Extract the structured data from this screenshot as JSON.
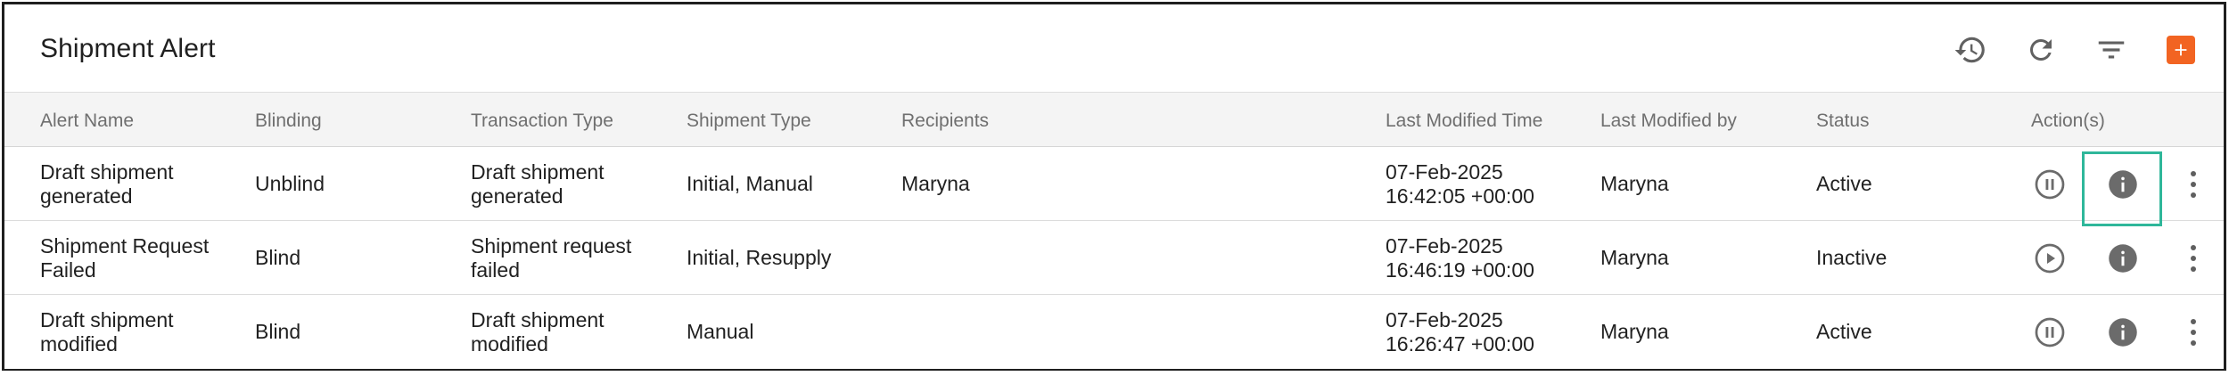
{
  "header": {
    "title": "Shipment Alert",
    "toolbar": [
      {
        "name": "history-icon",
        "label": "History"
      },
      {
        "name": "refresh-icon",
        "label": "Refresh"
      },
      {
        "name": "filter-icon",
        "label": "Filter"
      },
      {
        "name": "add-icon",
        "label": "Add",
        "color": "#f26422"
      }
    ]
  },
  "table": {
    "columns": [
      "Alert Name",
      "Blinding",
      "Transaction Type",
      "Shipment Type",
      "Recipients",
      "Last Modified Time",
      "Last Modified by",
      "Status",
      "Action(s)"
    ],
    "rows": [
      {
        "alert_name": [
          "Draft shipment",
          "generated"
        ],
        "blinding": "Unblind",
        "transaction_type": [
          "Draft shipment",
          "generated"
        ],
        "shipment_type": "Initial, Manual",
        "recipients": "Maryna",
        "last_modified_time": [
          "07-Feb-2025",
          "16:42:05 +00:00"
        ],
        "last_modified_by": "Maryna",
        "status": "Active",
        "toggle_icon": "pause-circle-icon"
      },
      {
        "alert_name": [
          "Shipment Request",
          "Failed"
        ],
        "blinding": "Blind",
        "transaction_type": [
          "Shipment request",
          "failed"
        ],
        "shipment_type": "Initial, Resupply",
        "recipients": "",
        "last_modified_time": [
          "07-Feb-2025",
          "16:46:19 +00:00"
        ],
        "last_modified_by": "Maryna",
        "status": "Inactive",
        "toggle_icon": "play-circle-icon"
      },
      {
        "alert_name": [
          "Draft shipment",
          "modified"
        ],
        "blinding": "Blind",
        "transaction_type": [
          "Draft shipment",
          "modified"
        ],
        "shipment_type": "Manual",
        "recipients": "",
        "last_modified_time": [
          "07-Feb-2025",
          "16:26:47 +00:00"
        ],
        "last_modified_by": "Maryna",
        "status": "Active",
        "toggle_icon": "pause-circle-icon"
      }
    ],
    "highlight_color": "#2fb79a"
  }
}
